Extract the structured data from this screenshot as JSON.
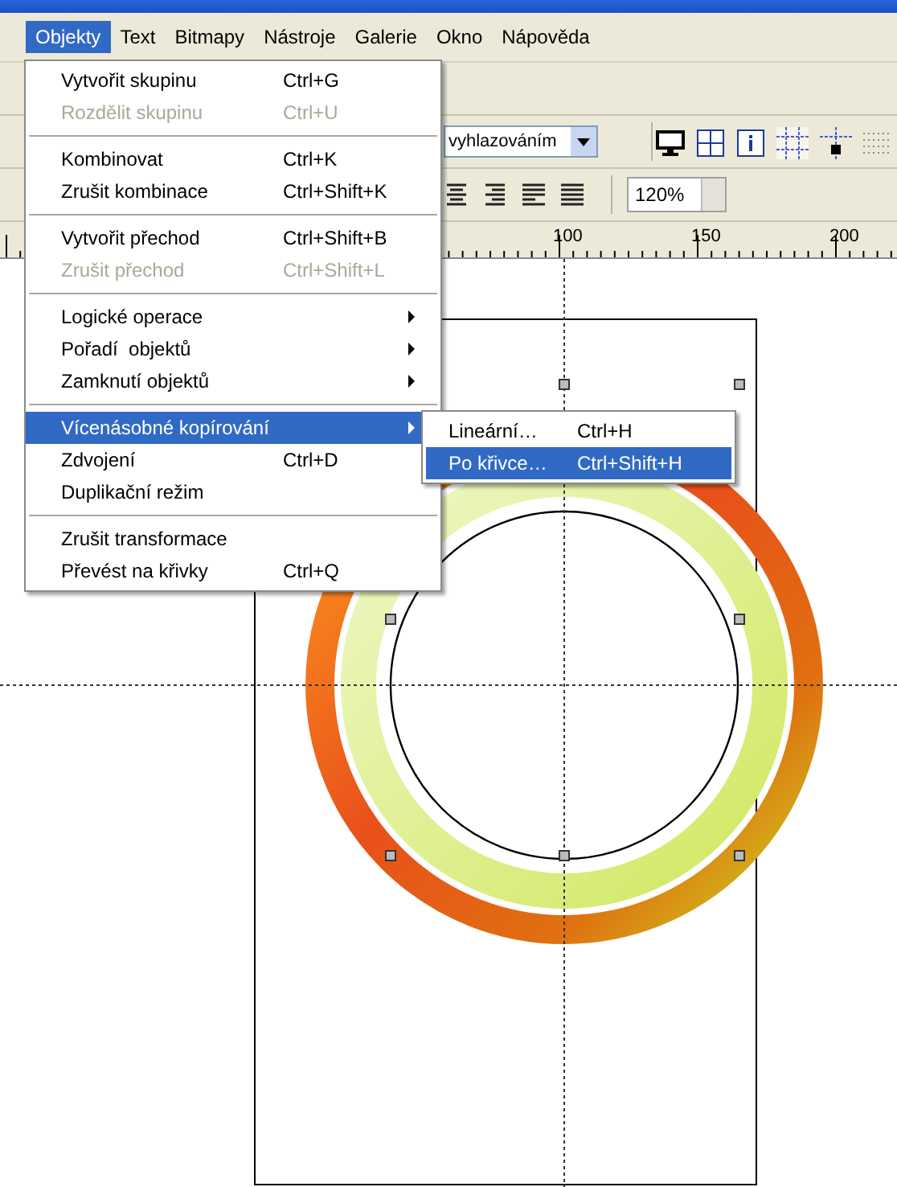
{
  "menubar": [
    {
      "label": "Objekty",
      "selected": true
    },
    {
      "label": "Text",
      "selected": false
    },
    {
      "label": "Bitmapy",
      "selected": false
    },
    {
      "label": "Nástroje",
      "selected": false
    },
    {
      "label": "Galerie",
      "selected": false
    },
    {
      "label": "Okno",
      "selected": false
    },
    {
      "label": "Nápověda",
      "selected": false
    }
  ],
  "toolbar": {
    "render_combo": {
      "value": "vyhlazováním"
    },
    "zoom": {
      "value": "120%"
    }
  },
  "ruler": {
    "labels": [
      "100",
      "150",
      "200"
    ]
  },
  "menu": {
    "groups": [
      {
        "items": [
          {
            "label": "Vytvořit skupinu",
            "shortcut": "Ctrl+G",
            "disabled": false,
            "selected": false,
            "submenu": false
          },
          {
            "label": "Rozdělit skupinu",
            "shortcut": "Ctrl+U",
            "disabled": true,
            "selected": false,
            "submenu": false
          }
        ]
      },
      {
        "items": [
          {
            "label": "Kombinovat",
            "shortcut": "Ctrl+K",
            "disabled": false,
            "selected": false,
            "submenu": false
          },
          {
            "label": "Zrušit kombinace",
            "shortcut": "Ctrl+Shift+K",
            "disabled": false,
            "selected": false,
            "submenu": false
          }
        ]
      },
      {
        "items": [
          {
            "label": "Vytvořit přechod",
            "shortcut": "Ctrl+Shift+B",
            "disabled": false,
            "selected": false,
            "submenu": false
          },
          {
            "label": "Zrušit přechod",
            "shortcut": "Ctrl+Shift+L",
            "disabled": true,
            "selected": false,
            "submenu": false
          }
        ]
      },
      {
        "items": [
          {
            "label": "Logické operace",
            "disabled": false,
            "selected": false,
            "submenu": true
          },
          {
            "label": "Pořadí  objektů",
            "disabled": false,
            "selected": false,
            "submenu": true
          },
          {
            "label": "Zamknutí objektů",
            "disabled": false,
            "selected": false,
            "submenu": true
          }
        ]
      },
      {
        "items": [
          {
            "label": "Vícenásobné kopírování",
            "disabled": false,
            "selected": true,
            "submenu": true
          },
          {
            "label": "Zdvojení",
            "shortcut": "Ctrl+D",
            "disabled": false,
            "selected": false,
            "submenu": false
          },
          {
            "label": "Duplikační režim",
            "disabled": false,
            "selected": false,
            "submenu": false
          }
        ]
      },
      {
        "items": [
          {
            "label": "Zrušit transformace",
            "disabled": false,
            "selected": false,
            "submenu": false
          },
          {
            "label": "Převést na křivky",
            "shortcut": "Ctrl+Q",
            "disabled": false,
            "selected": false,
            "submenu": false
          }
        ]
      }
    ]
  },
  "submenu": {
    "items": [
      {
        "label": "Lineární…",
        "shortcut": "Ctrl+H",
        "selected": false
      },
      {
        "label": "Po křivce…",
        "shortcut": "Ctrl+Shift+H",
        "selected": true
      }
    ]
  }
}
